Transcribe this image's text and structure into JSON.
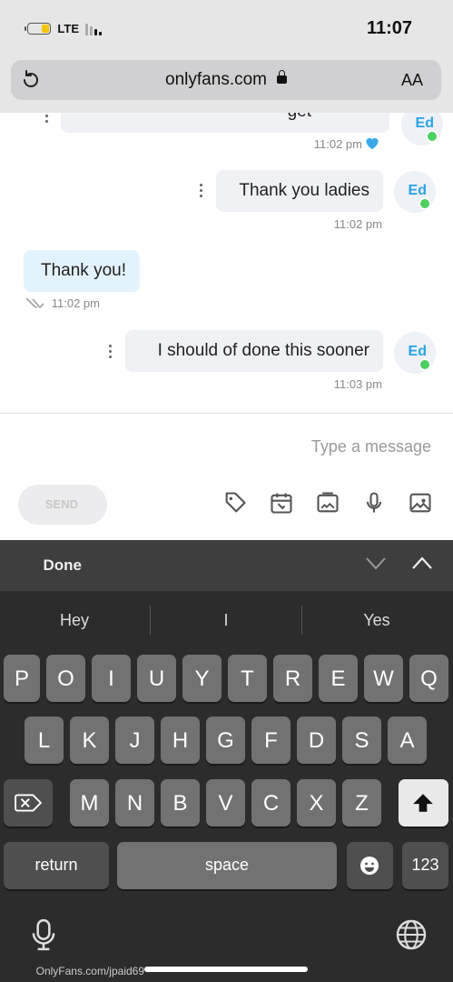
{
  "status": {
    "time": "11:07",
    "network": "LTE"
  },
  "browser": {
    "aa_label": "AA",
    "url": "onlyfans.com"
  },
  "chat": {
    "partial_message": {
      "text": "get",
      "time": "11:02 pm"
    },
    "messages": [
      {
        "sender_initials": "Ed",
        "text": "Thank you ladies",
        "time": "11:02 pm"
      },
      {
        "text": "Thank you!",
        "time": "11:02 pm"
      },
      {
        "sender_initials": "Ed",
        "text": "I should of done this sooner",
        "time": "11:03 pm"
      }
    ]
  },
  "composer": {
    "placeholder": "Type a message",
    "send_label": "SEND"
  },
  "keyboard": {
    "accessory": {
      "done_label": "Done"
    },
    "suggestions": [
      "Yes",
      "I",
      "Hey"
    ],
    "rows": [
      [
        "Q",
        "W",
        "E",
        "R",
        "T",
        "Y",
        "U",
        "I",
        "O",
        "P"
      ],
      [
        "A",
        "S",
        "D",
        "F",
        "G",
        "H",
        "J",
        "K",
        "L"
      ],
      [
        "Z",
        "X",
        "C",
        "V",
        "B",
        "N",
        "M"
      ]
    ],
    "numbers_label": "123",
    "space_label": "space",
    "return_label": "return"
  },
  "footer": {
    "url_text": "OnlyFans.com/jpaid69"
  },
  "colors": {
    "accent": "#2aa3e6",
    "online": "#4cd05f",
    "my_bubble": "#e3f3fd"
  }
}
